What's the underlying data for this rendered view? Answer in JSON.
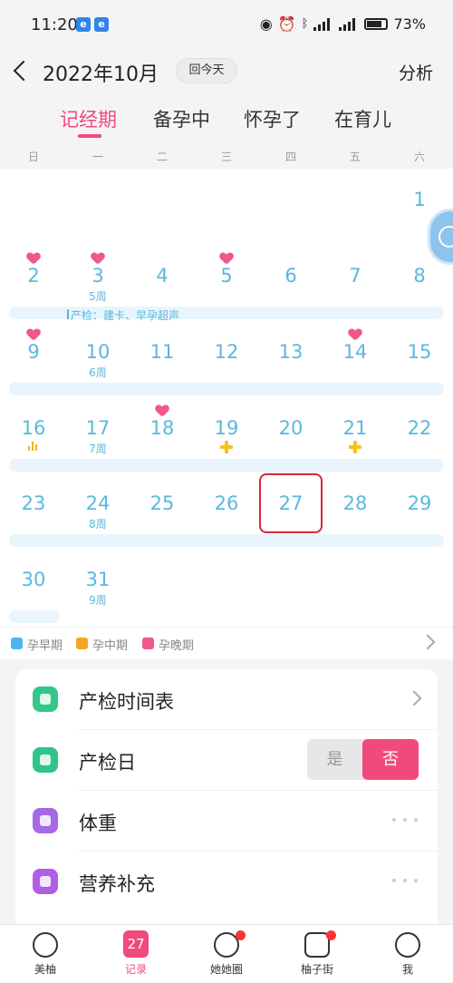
{
  "status": {
    "time": "11:20",
    "battery": "73%"
  },
  "header": {
    "title": "2022年10月",
    "today_button": "回今天",
    "analysis": "分析"
  },
  "tabs": [
    "记经期",
    "备孕中",
    "怀孕了",
    "在育儿"
  ],
  "active_tab": 0,
  "weekdays": [
    "日",
    "一",
    "二",
    "三",
    "四",
    "五",
    "六"
  ],
  "calendar": {
    "days": [
      "1",
      "2",
      "3",
      "4",
      "5",
      "6",
      "7",
      "8",
      "9",
      "10",
      "11",
      "12",
      "13",
      "14",
      "15",
      "16",
      "17",
      "18",
      "19",
      "20",
      "21",
      "22",
      "23",
      "24",
      "25",
      "26",
      "27",
      "28",
      "29",
      "30",
      "31"
    ],
    "week_labels": [
      "5周",
      "6周",
      "7周",
      "8周",
      "9周"
    ],
    "exam_note": "产检：建卡、早孕超声",
    "today": "27",
    "heart_days": [
      "2",
      "3",
      "5",
      "9",
      "14",
      "18"
    ],
    "plus_days": [
      "19",
      "21"
    ],
    "bars_days": [
      "16"
    ]
  },
  "legend": [
    {
      "label": "孕早期",
      "color": "#4bb6ee"
    },
    {
      "label": "孕中期",
      "color": "#f5a623"
    },
    {
      "label": "孕晚期",
      "color": "#f0578a"
    }
  ],
  "list": {
    "exam_schedule": "产检时间表",
    "exam_day": "产检日",
    "exam_day_yes": "是",
    "exam_day_no": "否",
    "weight": "体重",
    "nutrition": "营养补充"
  },
  "nav": [
    "美柚",
    "记录",
    "她她圈",
    "柚子街",
    "我"
  ],
  "nav_record_icon": "27",
  "colors": {
    "accent": "#f04a7c",
    "day_text": "#5ab8de",
    "today_border": "#d9263a"
  }
}
